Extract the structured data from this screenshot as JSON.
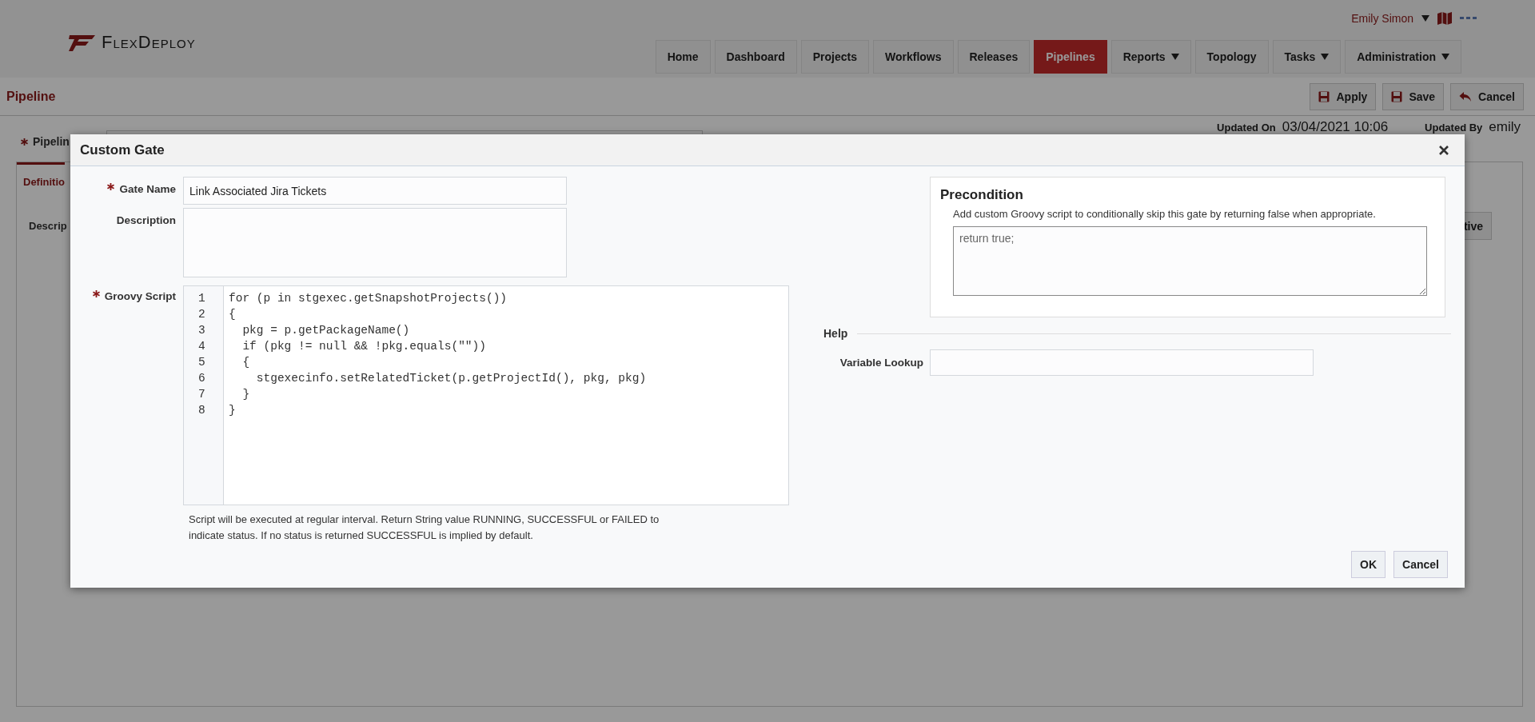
{
  "header": {
    "logo": "FlexDeploy",
    "user": "Emily Simon",
    "user_dropdown": true,
    "nav": [
      {
        "label": "Home",
        "selected": false,
        "dropdown": false
      },
      {
        "label": "Dashboard",
        "selected": false,
        "dropdown": false
      },
      {
        "label": "Projects",
        "selected": false,
        "dropdown": false
      },
      {
        "label": "Workflows",
        "selected": false,
        "dropdown": false
      },
      {
        "label": "Releases",
        "selected": false,
        "dropdown": false
      },
      {
        "label": "Pipelines",
        "selected": true,
        "dropdown": false
      },
      {
        "label": "Reports",
        "selected": false,
        "dropdown": true
      },
      {
        "label": "Topology",
        "selected": false,
        "dropdown": false
      },
      {
        "label": "Tasks",
        "selected": false,
        "dropdown": true
      },
      {
        "label": "Administration",
        "selected": false,
        "dropdown": true
      }
    ]
  },
  "page": {
    "title": "Pipeline",
    "actions": [
      {
        "label": "Apply",
        "kind": "save"
      },
      {
        "label": "Save",
        "kind": "save"
      },
      {
        "label": "Cancel",
        "kind": "undo"
      }
    ],
    "pipeline_label": "Pipelin",
    "pipeline_required": true,
    "updated_on_label": "Updated On",
    "updated_on": "03/04/2021 10:06",
    "updated_by_label": "Updated By",
    "updated_by": "emily",
    "tab": "Definitio",
    "description_label": "Descrip",
    "button_fragment": "tive"
  },
  "dialog": {
    "title": "Custom Gate",
    "gate_name": {
      "label": "Gate Name",
      "required": true,
      "value": "Link Associated Jira Tickets"
    },
    "description": {
      "label": "Description"
    },
    "groovy_script": {
      "label": "Groovy Script",
      "required": true,
      "lines": [
        {
          "number": "1",
          "code": "for (p in stgexec.getSnapshotProjects())"
        },
        {
          "number": "2",
          "code": "{"
        },
        {
          "number": "3",
          "code": "  pkg = p.getPackageName()"
        },
        {
          "number": "4",
          "code": "  if (pkg != null && !pkg.equals(\"\"))"
        },
        {
          "number": "5",
          "code": "  {"
        },
        {
          "number": "6",
          "code": "    stgexecinfo.setRelatedTicket(p.getProjectId(), pkg, pkg)"
        },
        {
          "number": "7",
          "code": "  }"
        },
        {
          "number": "8",
          "code": "}"
        }
      ]
    },
    "script_help": "Script will be executed at regular interval. Return String value RUNNING, SUCCESSFUL or FAILED to indicate status. If no status is returned SUCCESSFUL is implied by default.",
    "precondition": {
      "title": "Precondition",
      "text": "Add custom Groovy script to conditionally skip this gate by returning false when appropriate.",
      "value": "return true;"
    },
    "help": {
      "title": "Help",
      "variable_lookup_label": "Variable Lookup"
    },
    "buttons": [
      "OK",
      "Cancel"
    ]
  }
}
